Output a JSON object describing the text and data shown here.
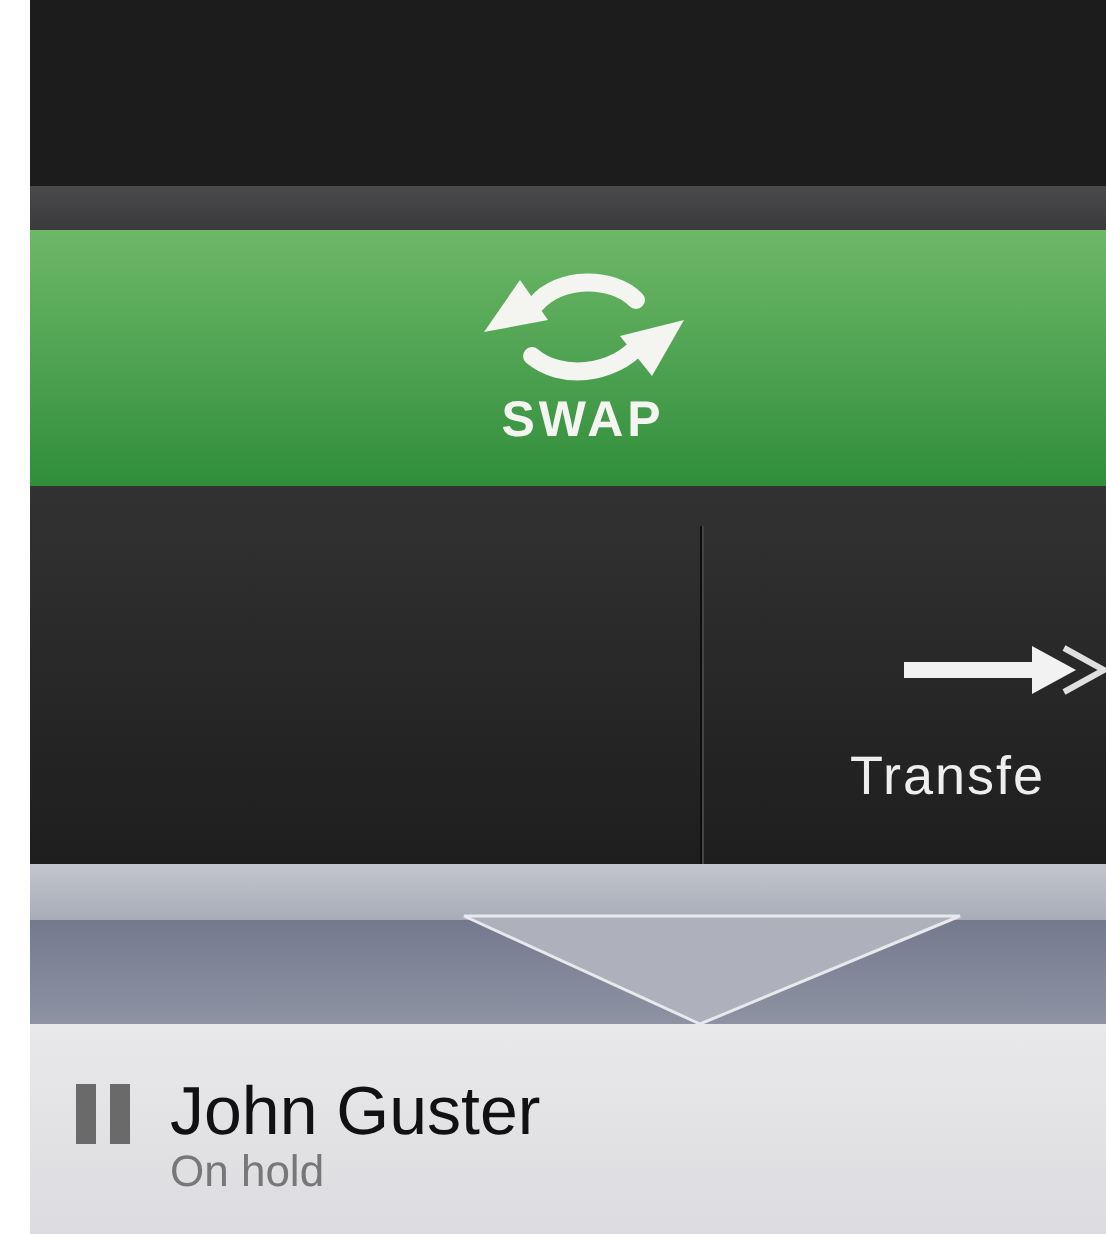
{
  "swap_button": {
    "label": "SWAP"
  },
  "transfer_button": {
    "label": "Transfe"
  },
  "call": {
    "name": "John Guster",
    "status": "On hold"
  }
}
